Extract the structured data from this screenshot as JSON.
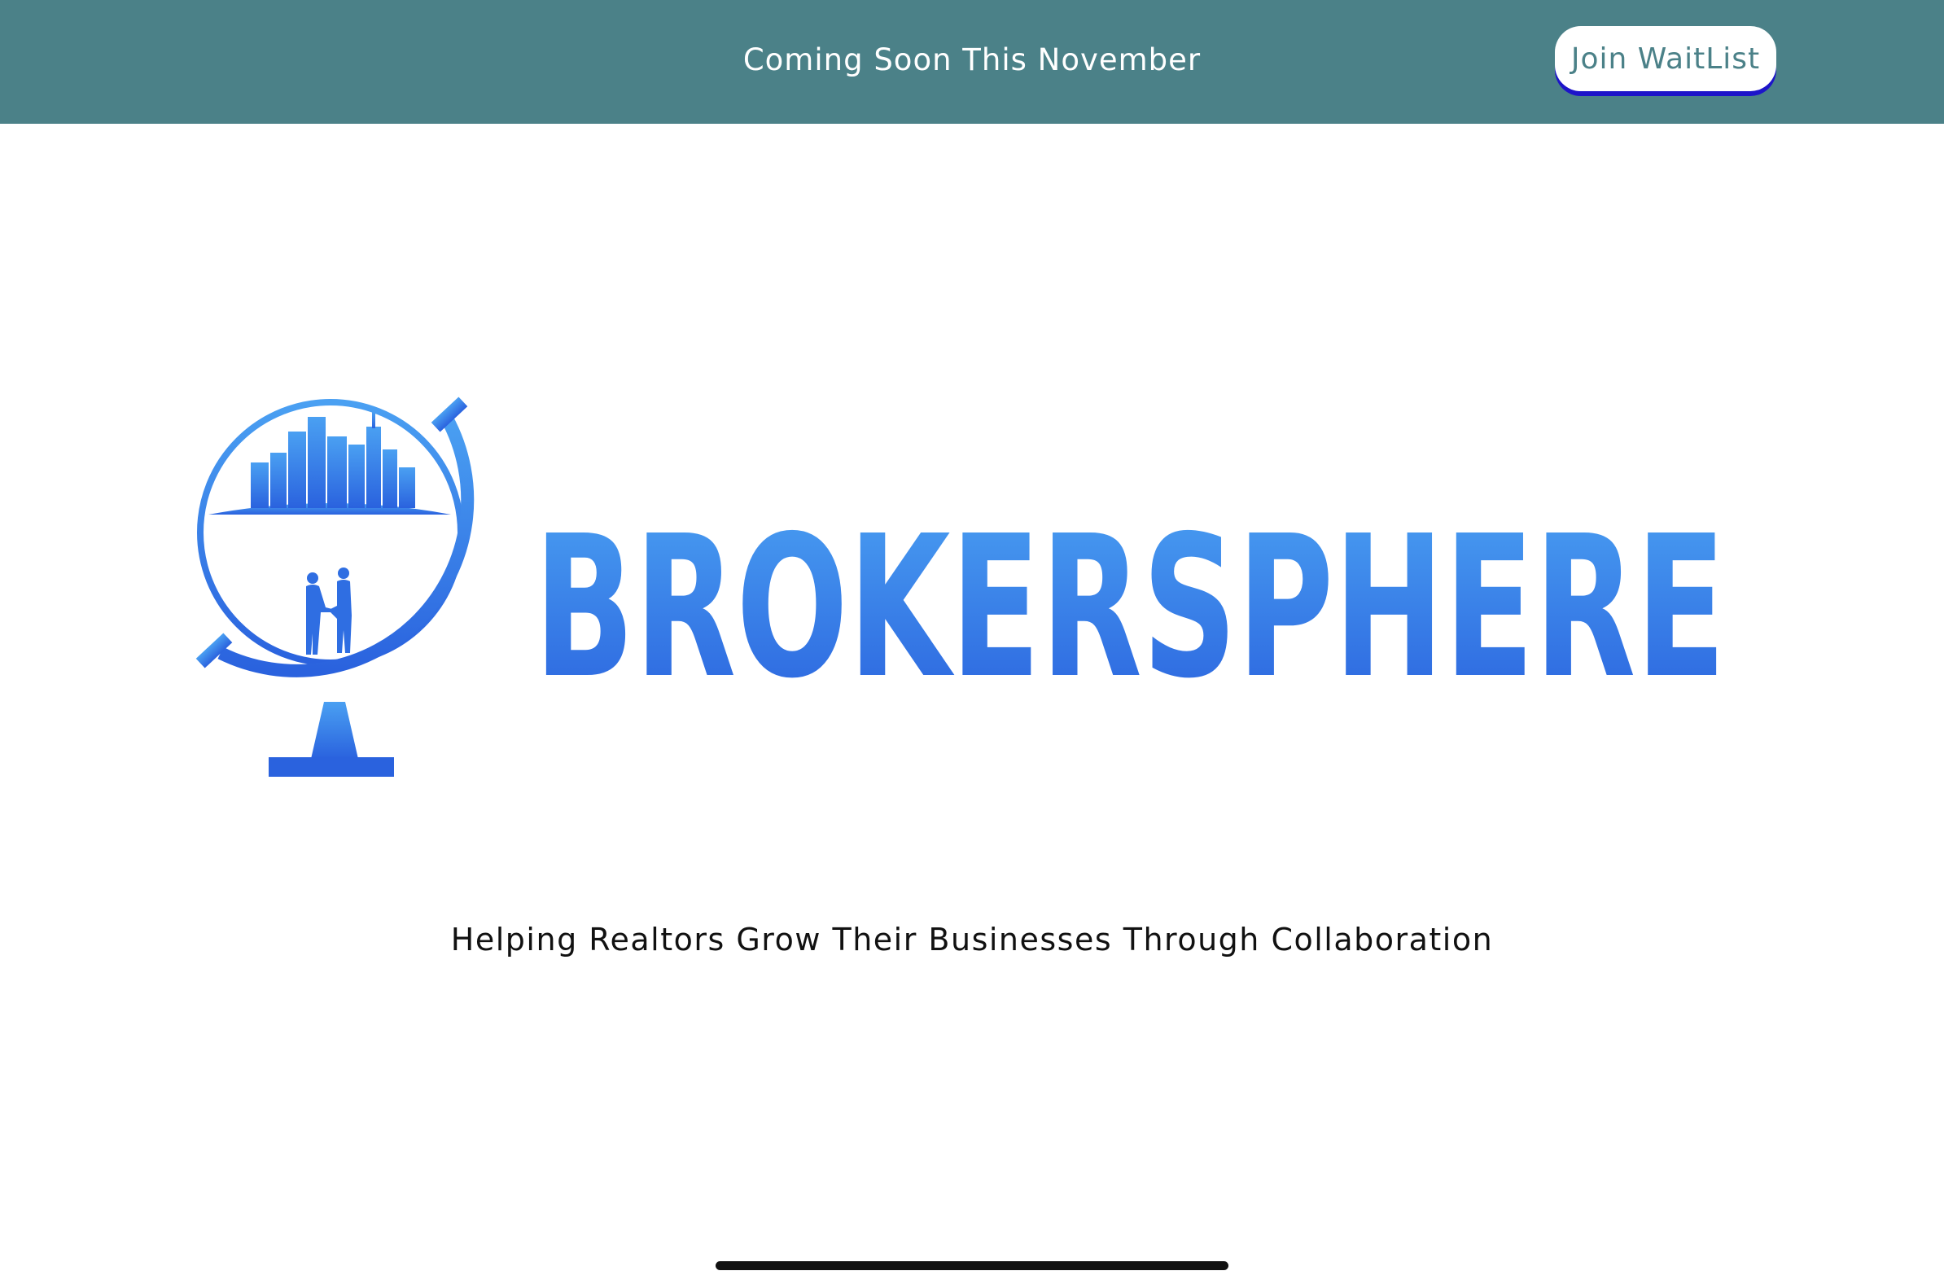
{
  "header": {
    "announcement": "Coming Soon This November",
    "waitlist_button_label": "Join WaitList"
  },
  "brand": {
    "wordmark": "BROKERSPHERE",
    "logo_icon": "globe-city-handshake-icon",
    "gradient_top_color": "#4aa0f2",
    "gradient_bottom_color": "#2a62de"
  },
  "main": {
    "tagline": "Helping Realtors Grow Their Businesses Through Collaboration"
  },
  "colors": {
    "header_background": "#4b8188",
    "button_text": "#4b8188",
    "button_shadow": "#1d14c9"
  }
}
